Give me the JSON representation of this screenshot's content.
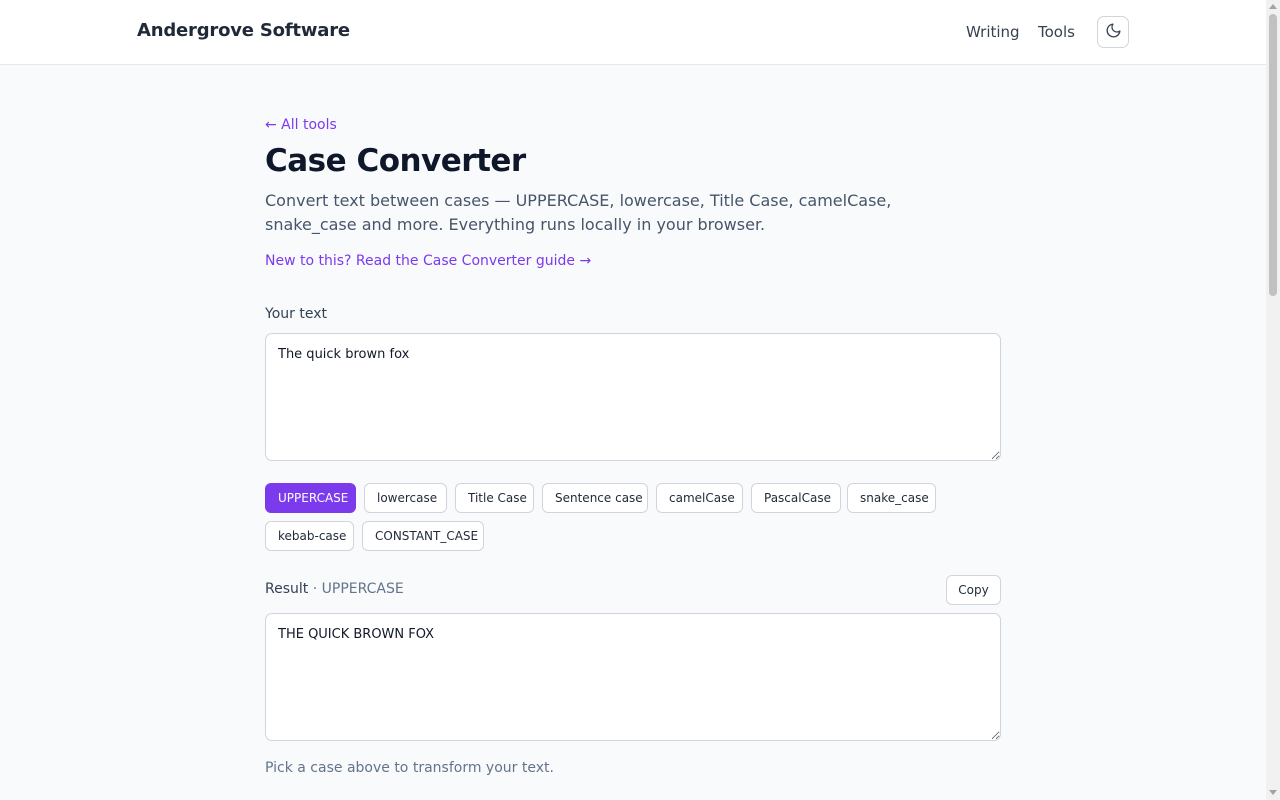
{
  "header": {
    "brand": "Andergrove Software",
    "nav": [
      {
        "label": "Writing"
      },
      {
        "label": "Tools"
      }
    ],
    "theme_icon": "moon-icon"
  },
  "page": {
    "back_link": "← All tools",
    "title": "Case Converter",
    "intro": "Convert text between cases — UPPERCASE, lowercase, Title Case, camelCase, snake_case and more. Everything runs locally in your browser.",
    "guide_link": "New to this? Read the Case Converter guide →"
  },
  "input": {
    "label": "Your text",
    "value": "The quick brown fox"
  },
  "cases": [
    {
      "label": "UPPERCASE",
      "active": true
    },
    {
      "label": "lowercase",
      "active": false
    },
    {
      "label": "Title Case",
      "active": false
    },
    {
      "label": "Sentence case",
      "active": false
    },
    {
      "label": "camelCase",
      "active": false
    },
    {
      "label": "PascalCase",
      "active": false
    },
    {
      "label": "snake_case",
      "active": false
    },
    {
      "label": "kebab-case",
      "active": false
    },
    {
      "label": "CONSTANT_CASE",
      "active": false
    }
  ],
  "result": {
    "label": "Result",
    "separator": "·",
    "current_case": "UPPERCASE",
    "copy_label": "Copy",
    "value": "THE QUICK BROWN FOX"
  },
  "hint": "Pick a case above to transform your text.",
  "colors": {
    "accent": "#7c3aed",
    "background": "#f8fafc",
    "text": "#0f172a",
    "muted": "#64748b"
  }
}
